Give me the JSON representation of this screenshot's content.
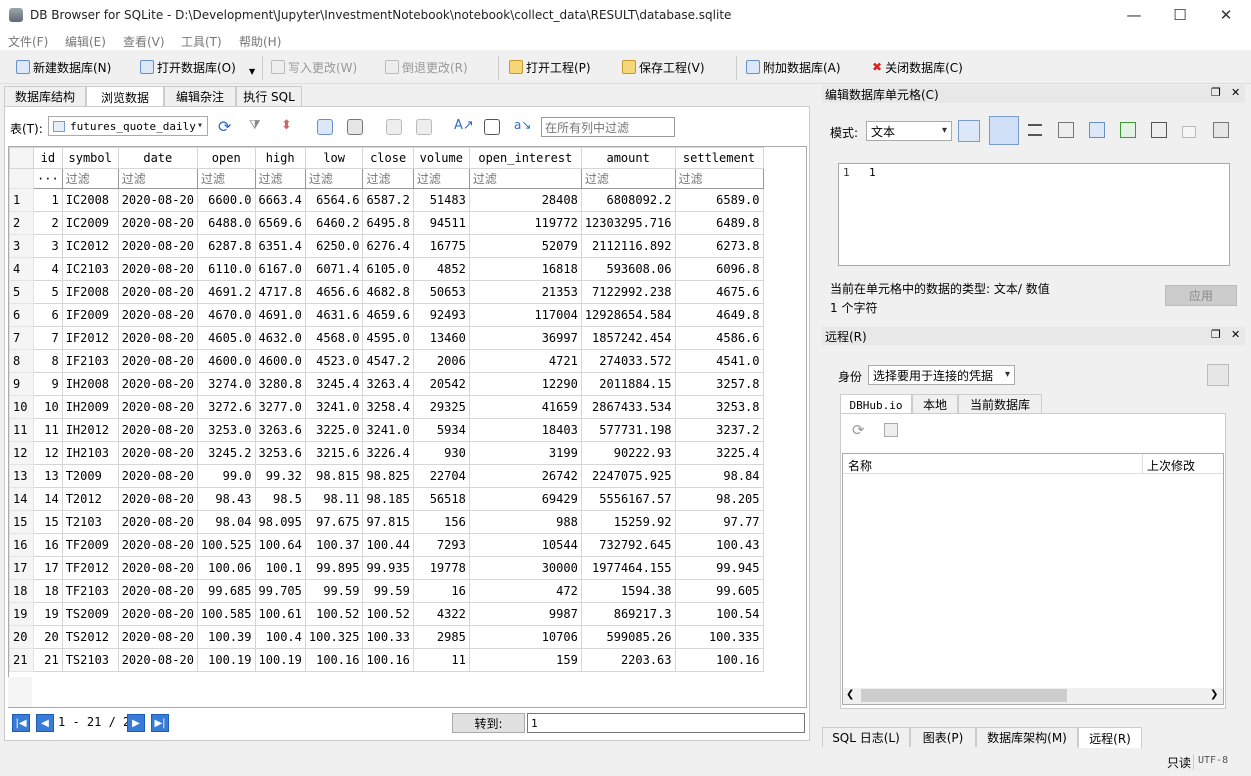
{
  "window": {
    "title": "DB Browser for SQLite - D:\\Development\\Jupyter\\InvestmentNotebook\\notebook\\collect_data\\RESULT\\database.sqlite"
  },
  "menu": [
    "文件(F)",
    "编辑(E)",
    "查看(V)",
    "工具(T)",
    "帮助(H)"
  ],
  "toolbar": {
    "new_db": "新建数据库(N)",
    "open_db": "打开数据库(O)",
    "write": "写入更改(W)",
    "revert": "倒退更改(R)",
    "open_proj": "打开工程(P)",
    "save_proj": "保存工程(V)",
    "attach": "附加数据库(A)",
    "close_db": "关闭数据库(C)"
  },
  "tabs": [
    "数据库结构",
    "浏览数据",
    "编辑杂注",
    "执行 SQL"
  ],
  "browse": {
    "table_label": "表(T):",
    "table_name": "futures_quote_daily",
    "filter_all_placeholder": "在所有列中过滤",
    "filter_placeholder": "过滤",
    "ellipsis": "···"
  },
  "grid": {
    "columns": [
      "id",
      "symbol",
      "date",
      "open",
      "high",
      "low",
      "close",
      "volume",
      "open_interest",
      "amount",
      "settlement"
    ],
    "rows": [
      [
        "1",
        "1",
        "IC2008",
        "2020-08-20",
        "6600.0",
        "6663.4",
        "6564.6",
        "6587.2",
        "51483",
        "28408",
        "6808092.2",
        "6589.0"
      ],
      [
        "2",
        "2",
        "IC2009",
        "2020-08-20",
        "6488.0",
        "6569.6",
        "6460.2",
        "6495.8",
        "94511",
        "119772",
        "12303295.716",
        "6489.8"
      ],
      [
        "3",
        "3",
        "IC2012",
        "2020-08-20",
        "6287.8",
        "6351.4",
        "6250.0",
        "6276.4",
        "16775",
        "52079",
        "2112116.892",
        "6273.8"
      ],
      [
        "4",
        "4",
        "IC2103",
        "2020-08-20",
        "6110.0",
        "6167.0",
        "6071.4",
        "6105.0",
        "4852",
        "16818",
        "593608.06",
        "6096.8"
      ],
      [
        "5",
        "5",
        "IF2008",
        "2020-08-20",
        "4691.2",
        "4717.8",
        "4656.6",
        "4682.8",
        "50653",
        "21353",
        "7122992.238",
        "4675.6"
      ],
      [
        "6",
        "6",
        "IF2009",
        "2020-08-20",
        "4670.0",
        "4691.0",
        "4631.6",
        "4659.6",
        "92493",
        "117004",
        "12928654.584",
        "4649.8"
      ],
      [
        "7",
        "7",
        "IF2012",
        "2020-08-20",
        "4605.0",
        "4632.0",
        "4568.0",
        "4595.0",
        "13460",
        "36997",
        "1857242.454",
        "4586.6"
      ],
      [
        "8",
        "8",
        "IF2103",
        "2020-08-20",
        "4600.0",
        "4600.0",
        "4523.0",
        "4547.2",
        "2006",
        "4721",
        "274033.572",
        "4541.0"
      ],
      [
        "9",
        "9",
        "IH2008",
        "2020-08-20",
        "3274.0",
        "3280.8",
        "3245.4",
        "3263.4",
        "20542",
        "12290",
        "2011884.15",
        "3257.8"
      ],
      [
        "10",
        "10",
        "IH2009",
        "2020-08-20",
        "3272.6",
        "3277.0",
        "3241.0",
        "3258.4",
        "29325",
        "41659",
        "2867433.534",
        "3253.8"
      ],
      [
        "11",
        "11",
        "IH2012",
        "2020-08-20",
        "3253.0",
        "3263.6",
        "3225.0",
        "3241.0",
        "5934",
        "18403",
        "577731.198",
        "3237.2"
      ],
      [
        "12",
        "12",
        "IH2103",
        "2020-08-20",
        "3245.2",
        "3253.6",
        "3215.6",
        "3226.4",
        "930",
        "3199",
        "90222.93",
        "3225.4"
      ],
      [
        "13",
        "13",
        "T2009",
        "2020-08-20",
        "99.0",
        "99.32",
        "98.815",
        "98.825",
        "22704",
        "26742",
        "2247075.925",
        "98.84"
      ],
      [
        "14",
        "14",
        "T2012",
        "2020-08-20",
        "98.43",
        "98.5",
        "98.11",
        "98.185",
        "56518",
        "69429",
        "5556167.57",
        "98.205"
      ],
      [
        "15",
        "15",
        "T2103",
        "2020-08-20",
        "98.04",
        "98.095",
        "97.675",
        "97.815",
        "156",
        "988",
        "15259.92",
        "97.77"
      ],
      [
        "16",
        "16",
        "TF2009",
        "2020-08-20",
        "100.525",
        "100.64",
        "100.37",
        "100.44",
        "7293",
        "10544",
        "732792.645",
        "100.43"
      ],
      [
        "17",
        "17",
        "TF2012",
        "2020-08-20",
        "100.06",
        "100.1",
        "99.895",
        "99.935",
        "19778",
        "30000",
        "1977464.155",
        "99.945"
      ],
      [
        "18",
        "18",
        "TF2103",
        "2020-08-20",
        "99.685",
        "99.705",
        "99.59",
        "99.59",
        "16",
        "472",
        "1594.38",
        "99.605"
      ],
      [
        "19",
        "19",
        "TS2009",
        "2020-08-20",
        "100.585",
        "100.61",
        "100.52",
        "100.52",
        "4322",
        "9987",
        "869217.3",
        "100.54"
      ],
      [
        "20",
        "20",
        "TS2012",
        "2020-08-20",
        "100.39",
        "100.4",
        "100.325",
        "100.33",
        "2985",
        "10706",
        "599085.26",
        "100.335"
      ],
      [
        "21",
        "21",
        "TS2103",
        "2020-08-20",
        "100.19",
        "100.19",
        "100.16",
        "100.16",
        "11",
        "159",
        "2203.63",
        "100.16"
      ]
    ]
  },
  "nav": {
    "records": "1 - 21 / 21",
    "goto_label": "转到:",
    "goto_value": "1"
  },
  "cell_editor": {
    "title": "编辑数据库单元格(C)",
    "mode_label": "模式:",
    "mode_value": "文本",
    "line_no": "1",
    "value": "1",
    "type_info": "当前在单元格中的数据的类型: 文本/ 数值",
    "char_count": "1 个字符",
    "apply": "应用"
  },
  "remote": {
    "title": "远程(R)",
    "identity_label": "身份",
    "identity_value": "选择要用于连接的凭据",
    "tabs": [
      "DBHub.io",
      "本地",
      "当前数据库"
    ],
    "col_name": "名称",
    "col_modified": "上次修改"
  },
  "bottom_tabs": [
    "SQL 日志(L)",
    "图表(P)",
    "数据库架构(M)",
    "远程(R)"
  ],
  "status": {
    "readonly": "只读",
    "encoding": "UTF-8"
  }
}
